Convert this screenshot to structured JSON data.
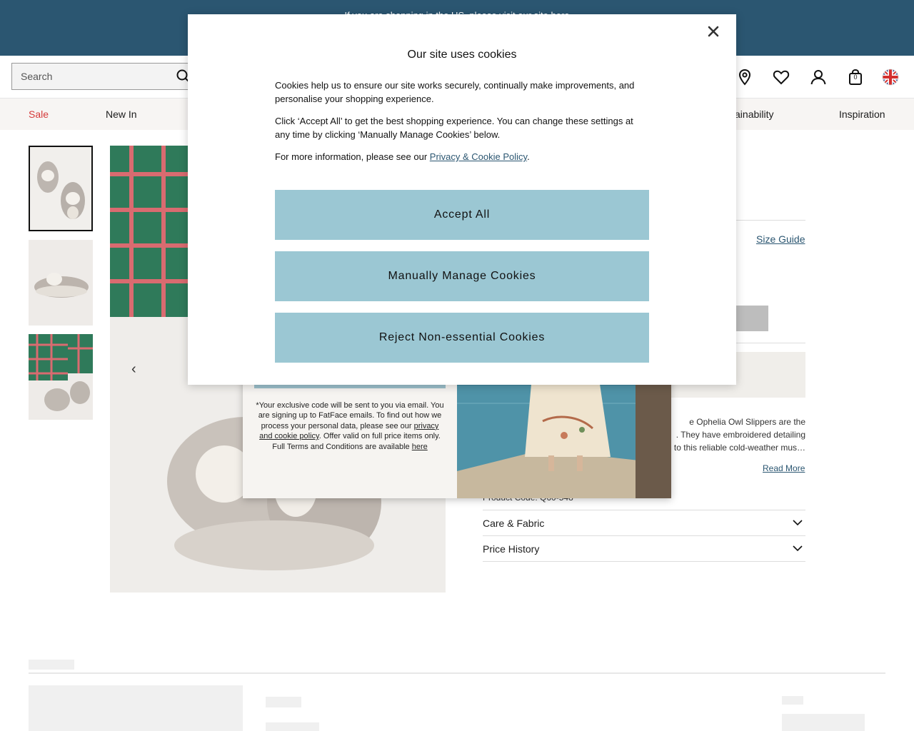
{
  "banner": {
    "text": "If you are shopping in the US, please visit our site here"
  },
  "header": {
    "search_placeholder": "Search",
    "icons": [
      "search-icon",
      "location-pin-icon",
      "heart-icon",
      "account-icon",
      "bag-icon",
      "uk-flag-icon"
    ],
    "bag_count": "0"
  },
  "nav": {
    "items": [
      {
        "label": "Sale"
      },
      {
        "label": "New In"
      },
      {
        "label": "Sustainability"
      },
      {
        "label": "Inspiration"
      }
    ]
  },
  "product": {
    "size_guide": "Size Guide",
    "description_lines": [
      "e Ophelia Owl Slippers are the",
      ". They have embroidered detailing",
      "to this reliable cold-weather mus…"
    ],
    "read_more": "Read More",
    "product_code": "Product Code: Q60-548",
    "accordions": [
      {
        "label": "Care & Fabric"
      },
      {
        "label": "Price History"
      }
    ],
    "gallery_prev": "‹"
  },
  "signup": {
    "fine_print_1": "*Your exclusive code will be sent to you via email. You are signing up to FatFace emails. To find out how we process your personal data, please see our",
    "privacy_link": "privacy and cookie policy",
    "fine_print_2": ". Offer valid on full price items only. Full Terms and Conditions are available",
    "terms_link": "here"
  },
  "cookie": {
    "title": "Our site uses cookies",
    "para1": "Cookies help us to ensure our site works securely, continually make improvements, and personalise your shopping experience.",
    "para2": "Click ‘Accept All’ to get the best shopping experience. You can change these settings at any time by clicking ‘Manually Manage Cookies’ below.",
    "para3_prefix": "For more information, please see our ",
    "policy_link": "Privacy & Cookie Policy",
    "para3_suffix": ".",
    "accept_all": "Accept All",
    "manage": "Manually Manage Cookies",
    "reject": "Reject Non-essential Cookies"
  },
  "colors": {
    "banner": "#2b5671",
    "cookie_button": "#9bc7d3",
    "sale": "#d53a3a",
    "link": "#2b5671"
  }
}
